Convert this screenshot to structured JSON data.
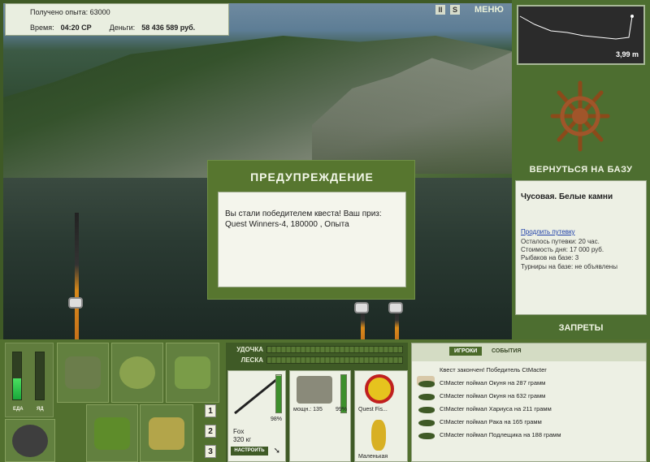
{
  "header": {
    "experience_label": "Получено опыта: 63000",
    "time_label": "Время:",
    "time_value": "04:20 СР",
    "money_label": "Деньги:",
    "money_value": "58 436 589 руб.",
    "pause_icon": "pause-icon",
    "sound_icon": "sound-icon",
    "menu_label": "МЕНЮ"
  },
  "depth_map": {
    "depth_value": "3,99 m"
  },
  "right_panel": {
    "back_to_base": "ВЕРНУТЬСЯ НА БАЗУ",
    "location_name": "Чусовая. Белые камни",
    "extend_link": "Продлить путевку",
    "remaining": "Осталось путевки: 20 час.",
    "day_cost": "Стоимость дня: 17 000 руб.",
    "fishers": "Рыбаков на базе: 3",
    "tournaments": "Турниры на базе: не объявлены",
    "restrictions": "ЗАПРЕТЫ"
  },
  "warning": {
    "title": "ПРЕДУПРЕЖДЕНИЕ",
    "line1": "Вы стали победителем квеста! Ваш приз:",
    "line2": "Quest Winners-4, 180000 , Опыта"
  },
  "status_bars": {
    "food_label": "ЕДА",
    "poison_label": "ЯД",
    "food_level": 0.45,
    "poison_level": 0.0
  },
  "inventory_pages": [
    "1",
    "2",
    "3"
  ],
  "tackle": {
    "rod_label": "УДОЧКА",
    "line_label": "ЛЕСКА",
    "rod_name": "Fox",
    "rod_weight": "320 кг",
    "rod_percent": "98%",
    "setup_button": "НАСТРОИТЬ",
    "reel_power": "мощн.: 135",
    "reel_percent": "99%",
    "line_name": "Quest Fis...",
    "lure_name": "Маленькая"
  },
  "events": {
    "tab_players": "ИГРОКИ",
    "tab_events": "СОБЫТИЯ",
    "items": [
      "Квест закончен! Победитель CtMacter",
      "CtMacter поймал Окуня на 287 грамм",
      "CtMacter поймал Окуня на 632 грамм",
      "CtMacter поймал Хариуса на 211 грамм",
      "CtMacter поймал Рака на 165 грамм",
      "CtMacter поймал Подлещика на 188 грамм"
    ]
  }
}
